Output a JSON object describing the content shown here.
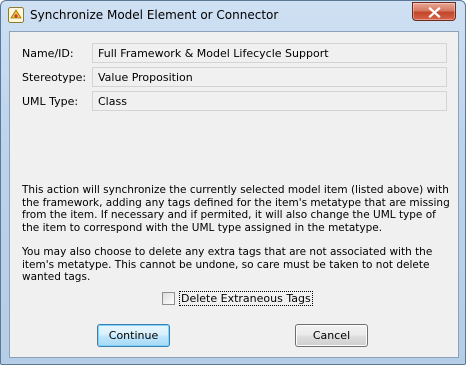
{
  "window": {
    "title": "Synchronize Model Element or Connector"
  },
  "fields": [
    {
      "label": "Name/ID:",
      "value": "Full Framework & Model Lifecycle Support"
    },
    {
      "label": "Stereotype:",
      "value": "Value Proposition"
    },
    {
      "label": "UML Type:",
      "value": "Class"
    }
  ],
  "description": {
    "paragraph1": "This action will synchronize the currently selected model item (listed above) with the framework, adding any tags defined for the item's metatype that are missing from the item. If necessary and if permited, it will also change the UML type of the item to correspond with the UML type assigned in the metatype.",
    "paragraph2": "You may also choose to delete any extra tags that are not associated with the item's metatype. This cannot be undone, so care must be taken to not delete wanted tags."
  },
  "options": {
    "delete_extraneous_tags_label": "Delete Extraneous Tags",
    "delete_extraneous_tags_checked": false
  },
  "buttons": {
    "continue_label": "Continue",
    "cancel_label": "Cancel"
  },
  "icons": {
    "title_icon": "app-icon",
    "close": "close-icon"
  }
}
